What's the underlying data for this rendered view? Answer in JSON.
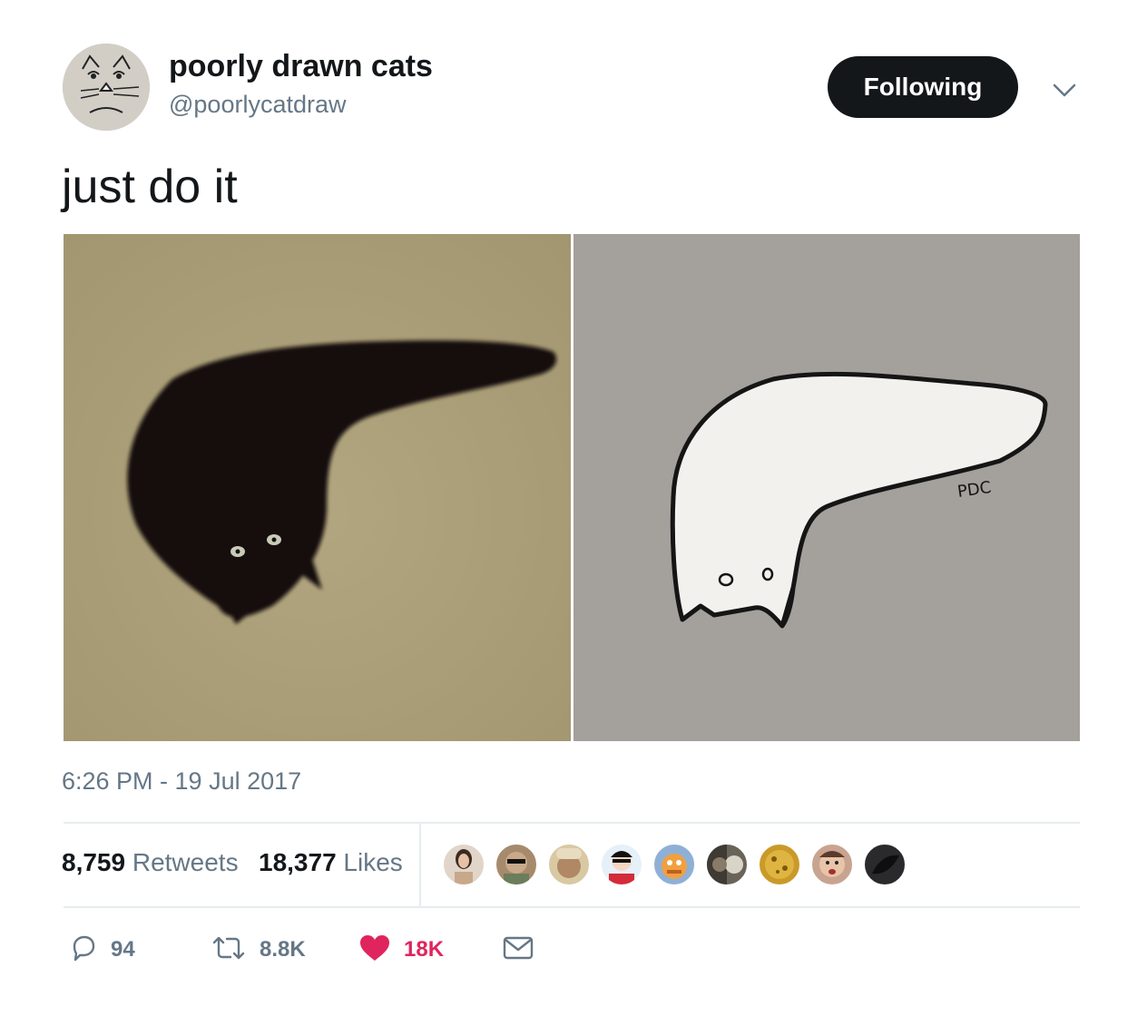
{
  "author": {
    "display_name": "poorly drawn cats",
    "handle": "@poorlycatdraw",
    "avatar_icon": "cat-sketch-avatar"
  },
  "follow_button": {
    "label": "Following"
  },
  "tweet": {
    "text": "just do it",
    "timestamp": "6:26 PM - 19 Jul 2017",
    "drawing_signature": "PDC"
  },
  "stats": {
    "retweets": {
      "count": "8,759",
      "label": "Retweets"
    },
    "likes": {
      "count": "18,377",
      "label": "Likes"
    }
  },
  "actions": {
    "reply": {
      "icon": "reply-icon",
      "count": "94"
    },
    "retweet": {
      "icon": "retweet-icon",
      "count": "8.8K"
    },
    "like": {
      "icon": "heart-icon",
      "count": "18K"
    },
    "message": {
      "icon": "mail-icon"
    }
  },
  "colors": {
    "text": "#14171a",
    "secondary": "#657786",
    "like": "#e0245e",
    "divider": "#e6ecf0",
    "button": "#14171a"
  }
}
